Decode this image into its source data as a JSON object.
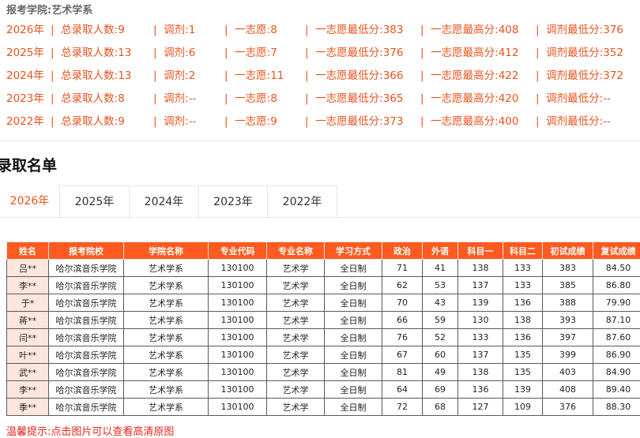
{
  "header": {
    "school_label": "报考学院:艺术学系"
  },
  "stats": [
    {
      "year": "2026年",
      "total": "总录取人数:9",
      "adjust": "调剂:1",
      "first": "一志愿:8",
      "first_min": "一志愿最低分:383",
      "first_max": "一志愿最高分:408",
      "adjust_min": "调剂最低分:376"
    },
    {
      "year": "2025年",
      "total": "总录取人数:13",
      "adjust": "调剂:6",
      "first": "一志愿:7",
      "first_min": "一志愿最低分:376",
      "first_max": "一志愿最高分:412",
      "adjust_min": "调剂最低分:352"
    },
    {
      "year": "2024年",
      "total": "总录取人数:13",
      "adjust": "调剂:2",
      "first": "一志愿:11",
      "first_min": "一志愿最低分:366",
      "first_max": "一志愿最高分:422",
      "adjust_min": "调剂最低分:372"
    },
    {
      "year": "2023年",
      "total": "总录取人数:8",
      "adjust": "调剂:--",
      "first": "一志愿:8",
      "first_min": "一志愿最低分:365",
      "first_max": "一志愿最高分:420",
      "adjust_min": "调剂最低分:--"
    },
    {
      "year": "2022年",
      "total": "总录取人数:9",
      "adjust": "调剂:--",
      "first": "一志愿:9",
      "first_min": "一志愿最低分:373",
      "first_max": "一志愿最高分:400",
      "adjust_min": "调剂最低分:--"
    }
  ],
  "section_title": "录取名单",
  "tabs": [
    "2026年",
    "2025年",
    "2024年",
    "2023年",
    "2022年"
  ],
  "active_tab": "2026年",
  "table": {
    "headers": [
      "姓名",
      "报考院校",
      "学院名称",
      "专业代码",
      "专业名称",
      "学习方式",
      "政治",
      "外语",
      "科目一",
      "科目二",
      "初试成绩",
      "复试成绩"
    ],
    "rows": [
      [
        "吕**",
        "哈尔滨音乐学院",
        "艺术学系",
        "130100",
        "艺术学",
        "全日制",
        "71",
        "41",
        "138",
        "133",
        "383",
        "84.50"
      ],
      [
        "李**",
        "哈尔滨音乐学院",
        "艺术学系",
        "130100",
        "艺术学",
        "全日制",
        "62",
        "53",
        "137",
        "133",
        "385",
        "86.80"
      ],
      [
        "于*",
        "哈尔滨音乐学院",
        "艺术学系",
        "130100",
        "艺术学",
        "全日制",
        "70",
        "43",
        "139",
        "136",
        "388",
        "79.90"
      ],
      [
        "蒋**",
        "哈尔滨音乐学院",
        "艺术学系",
        "130100",
        "艺术学",
        "全日制",
        "66",
        "59",
        "130",
        "138",
        "393",
        "87.10"
      ],
      [
        "闫**",
        "哈尔滨音乐学院",
        "艺术学系",
        "130100",
        "艺术学",
        "全日制",
        "76",
        "52",
        "133",
        "136",
        "397",
        "87.60"
      ],
      [
        "叶**",
        "哈尔滨音乐学院",
        "艺术学系",
        "130100",
        "艺术学",
        "全日制",
        "67",
        "60",
        "137",
        "135",
        "399",
        "86.90"
      ],
      [
        "武**",
        "哈尔滨音乐学院",
        "艺术学系",
        "130100",
        "艺术学",
        "全日制",
        "81",
        "49",
        "138",
        "135",
        "403",
        "84.90"
      ],
      [
        "李**",
        "哈尔滨音乐学院",
        "艺术学系",
        "130100",
        "艺术学",
        "全日制",
        "64",
        "69",
        "136",
        "139",
        "408",
        "89.40"
      ],
      [
        "季**",
        "哈尔滨音乐学院",
        "艺术学系",
        "130100",
        "艺术学",
        "全日制",
        "72",
        "68",
        "127",
        "109",
        "376",
        "88.30"
      ]
    ]
  },
  "hint": "温馨提示:点击图片可以查看高清原图"
}
